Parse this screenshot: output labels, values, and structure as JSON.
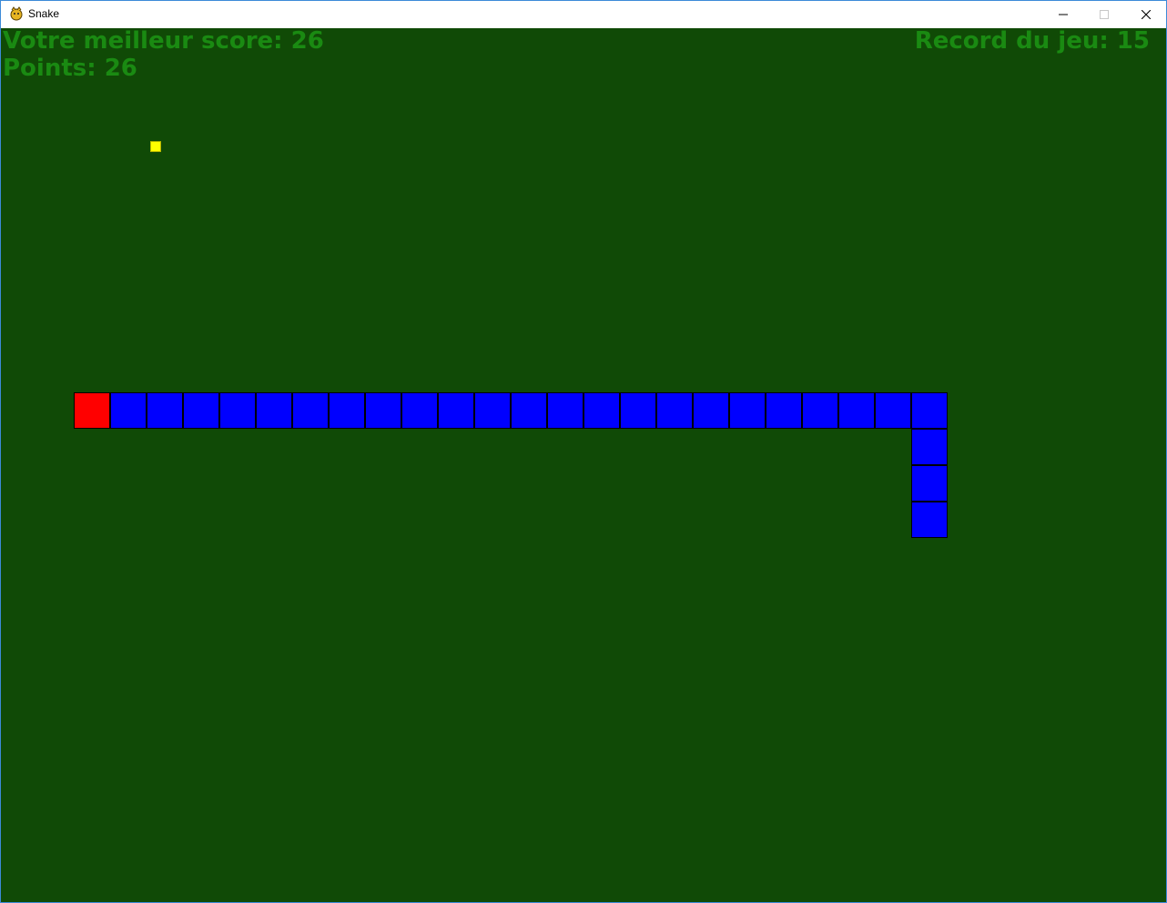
{
  "window": {
    "title": "Snake",
    "app_icon": "pygame-snake-icon",
    "controls": {
      "minimize": "minimize-icon",
      "maximize": "maximize-icon",
      "close": "close-icon"
    }
  },
  "colors": {
    "background": "#104a06",
    "hud_text": "#1a8a12",
    "snake_head": "#ff0000",
    "snake_body": "#0000ff",
    "food": "#ffff00"
  },
  "hud": {
    "best_score": "Votre meilleur score: 26",
    "points": "Points: 26",
    "game_record": "Record du jeu: 15"
  },
  "grid": {
    "cell": 40
  },
  "food": {
    "col": 4.25,
    "row": 3.25
  },
  "snake": {
    "head": {
      "col": 2,
      "row": 10
    },
    "body": [
      {
        "col": 3,
        "row": 10
      },
      {
        "col": 4,
        "row": 10
      },
      {
        "col": 5,
        "row": 10
      },
      {
        "col": 6,
        "row": 10
      },
      {
        "col": 7,
        "row": 10
      },
      {
        "col": 8,
        "row": 10
      },
      {
        "col": 9,
        "row": 10
      },
      {
        "col": 10,
        "row": 10
      },
      {
        "col": 11,
        "row": 10
      },
      {
        "col": 12,
        "row": 10
      },
      {
        "col": 13,
        "row": 10
      },
      {
        "col": 14,
        "row": 10
      },
      {
        "col": 15,
        "row": 10
      },
      {
        "col": 16,
        "row": 10
      },
      {
        "col": 17,
        "row": 10
      },
      {
        "col": 18,
        "row": 10
      },
      {
        "col": 19,
        "row": 10
      },
      {
        "col": 20,
        "row": 10
      },
      {
        "col": 21,
        "row": 10
      },
      {
        "col": 22,
        "row": 10
      },
      {
        "col": 23,
        "row": 10
      },
      {
        "col": 24,
        "row": 10
      },
      {
        "col": 25,
        "row": 10
      },
      {
        "col": 25,
        "row": 11
      },
      {
        "col": 25,
        "row": 12
      },
      {
        "col": 25,
        "row": 13
      }
    ]
  }
}
